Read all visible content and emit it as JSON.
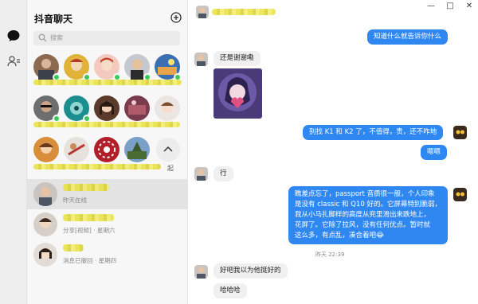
{
  "sidebar": {
    "title": "抖音聊天",
    "search_placeholder": "搜索",
    "expand_label": "起"
  },
  "conversations": [
    {
      "status": "昨天在线"
    },
    {
      "status": "分享[视频] · 星期六"
    },
    {
      "status": "消息已撤回 · 星期四"
    }
  ],
  "chat": {
    "window_controls": [
      "—",
      "□",
      "✕"
    ],
    "messages": [
      {
        "text": "知道什么就告诉你什么"
      },
      {
        "text": "还是谢谢嘞"
      },
      {
        "text": "别找 K1 和 K2 了，不值得，贵，还不咋地"
      },
      {
        "text": "嗯嗯"
      },
      {
        "text": "行"
      },
      {
        "lines": [
          "瞧差点忘了，passport 音质很一般，个人印象",
          "是没有 classic 和 Q10 好的。它屏幕特别脆弱，",
          "我从小马扎脚样的高度从兜里滑出来跌地上，",
          "花屏了。它除了拉风，没有任何优点。暂时就",
          "这么多，有点乱，凑合着吧😂"
        ]
      },
      {
        "text": "好吧我以为他挺好的"
      },
      {
        "text": "哈哈哈"
      }
    ],
    "timestamp": "昨天 22:39"
  },
  "colors": {
    "accent": "#2f88f2",
    "online": "#3bc95a"
  }
}
